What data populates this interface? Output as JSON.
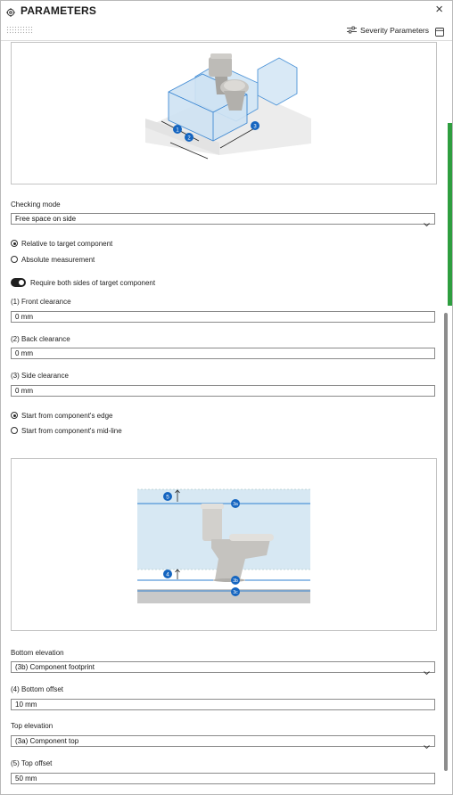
{
  "window": {
    "title": "PARAMETERS",
    "close_glyph": "×",
    "icons": {
      "title": "gear-icon",
      "close": "close-icon"
    }
  },
  "toolbar": {
    "severity_label": "Severity Parameters",
    "icons": {
      "severity": "sliders-icon",
      "panel": "panel-toggle-icon",
      "grip": "drag-grip-icon"
    }
  },
  "checking_mode": {
    "label": "Checking mode",
    "value": "Free space on side",
    "icon": "chevron-down-icon"
  },
  "measurement": {
    "options": [
      {
        "label": "Relative to target component",
        "selected": true
      },
      {
        "label": "Absolute measurement",
        "selected": false
      }
    ]
  },
  "require_both": {
    "label": "Require both sides of target component",
    "on": true
  },
  "clearances": {
    "front": {
      "label": "(1) Front clearance",
      "value": "0 mm"
    },
    "back": {
      "label": "(2) Back clearance",
      "value": "0 mm"
    },
    "side": {
      "label": "(3) Side clearance",
      "value": "0 mm"
    }
  },
  "start_from": {
    "options": [
      {
        "label": "Start from component's edge",
        "selected": true
      },
      {
        "label": "Start from component's mid-line",
        "selected": false
      }
    ]
  },
  "diagram_top": {
    "badges": [
      "1",
      "2",
      "3"
    ]
  },
  "diagram_bottom": {
    "badges": {
      "b5": "5",
      "b4": "4",
      "b3a": "3a",
      "b3b": "3b",
      "b3c": "3c"
    }
  },
  "bottom_elevation": {
    "label": "Bottom elevation",
    "value": "(3b) Component footprint"
  },
  "bottom_offset": {
    "label": "(4) Bottom offset",
    "value": "10 mm"
  },
  "top_elevation": {
    "label": "Top elevation",
    "value": "(3a) Component top"
  },
  "top_offset": {
    "label": "(5) Top offset",
    "value": "50 mm"
  },
  "colors": {
    "accent_green": "#2e9e3f",
    "badge_blue": "#1565c0",
    "zone_blue": "#d7e8f3",
    "line_blue": "#2e7fd0"
  }
}
